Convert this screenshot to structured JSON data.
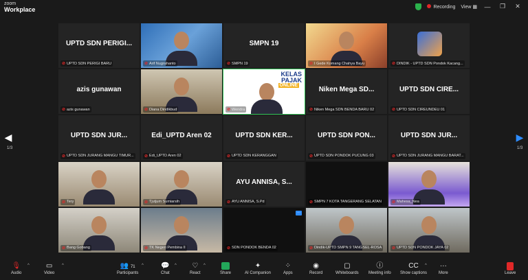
{
  "app": {
    "logo_line1": "zoom",
    "logo_line2": "Workplace"
  },
  "titlebar": {
    "recording": "Recording",
    "view": "View",
    "minimize": "—",
    "maximize": "❐",
    "close": "✕"
  },
  "tiles": [
    {
      "big": "UPTD SDN PERIGI...",
      "label": "UPTD SDN PERIGI BARU",
      "bg": ""
    },
    {
      "big": "",
      "label": "Arif Nugrahanto",
      "bg": "photo-blue"
    },
    {
      "big": "SMPN 19",
      "label": "SMPN 19",
      "bg": ""
    },
    {
      "big": "",
      "label": "I Gede Komang Chahya Bayu",
      "bg": "photo-warm"
    },
    {
      "big": "",
      "label": "DINDIK - UPTD SDN Pondok Kacang...",
      "bg": "avatar"
    },
    {
      "big": "azis gunawan",
      "label": "azis gunawan",
      "bg": ""
    },
    {
      "big": "",
      "label": "Diana Dindikbud",
      "bg": "photo-room"
    },
    {
      "big": "",
      "label": "Wendra",
      "bg": "slide"
    },
    {
      "big": "Niken Mega SD...",
      "label": "Niken Mega SDN BENDA BARU 02",
      "bg": ""
    },
    {
      "big": "UPTD SDN CIRE...",
      "label": "UPTD SDN CIREUNDEU 01",
      "bg": ""
    },
    {
      "big": "UPTD SDN JUR...",
      "label": "UPTD SDN JURANG MANGU TIMUR...",
      "bg": ""
    },
    {
      "big": "Edi_UPTD Aren 02",
      "label": "Edi_UPTD Aren 02",
      "bg": ""
    },
    {
      "big": "UPTD SDN KER...",
      "label": "UPTD SDN KERANGGAN",
      "bg": ""
    },
    {
      "big": "UPTD SDN PON...",
      "label": "UPTD SDN PONDOK PUCUNG 03",
      "bg": ""
    },
    {
      "big": "UPTD SDN JUR...",
      "label": "UPTD SDN JURANG MANGU BARAT...",
      "bg": ""
    },
    {
      "big": "",
      "label": "Tery",
      "bg": "photo-person"
    },
    {
      "big": "",
      "label": "Tjutjum Sumiarsih",
      "bg": "photo-person"
    },
    {
      "big": "AYU ANNISA, S...",
      "label": "AYU ANNISA, S.Pd",
      "bg": ""
    },
    {
      "big": "",
      "label": "SMPN 7 KOTA TANGERANG SELATAN",
      "bg": "photo-dark"
    },
    {
      "big": "",
      "label": "Mahesa_Nea",
      "bg": "photo-hijab"
    },
    {
      "big": "",
      "label": "Bang Gobang",
      "bg": "photo-office"
    },
    {
      "big": "",
      "label": "TK Negeri Pembina II",
      "bg": "photo-girl"
    },
    {
      "big": "",
      "label": "SDN PONDOK BENDA 02",
      "bg": "photo-dark"
    },
    {
      "big": "",
      "label": "Dindik-UPTD SMPN 9 TANGSEL-ROSA",
      "bg": "photo-window"
    },
    {
      "big": "",
      "label": "UPTD SDN PONDOK JAYA 02",
      "bg": "photo-window"
    }
  ],
  "slide": {
    "line1": "KELAS",
    "line2": "PAJAK",
    "line3": "ONLINE"
  },
  "pager": {
    "left": "1/3",
    "right": "1/3"
  },
  "toolbar": {
    "audio": "Audio",
    "video": "Video",
    "participants": "Participants",
    "participant_count": "71",
    "chat": "Chat",
    "react": "React",
    "share": "Share",
    "ai": "AI Companion",
    "apps": "Apps",
    "record": "Record",
    "whiteboards": "Whiteboards",
    "meeting_info": "Meeting info",
    "captions": "Show captions",
    "more": "More",
    "leave": "Leave"
  },
  "colors": {
    "accent": "#2d8cff",
    "active_speaker": "#35c759",
    "danger": "#e02828",
    "share": "#23a75a"
  }
}
